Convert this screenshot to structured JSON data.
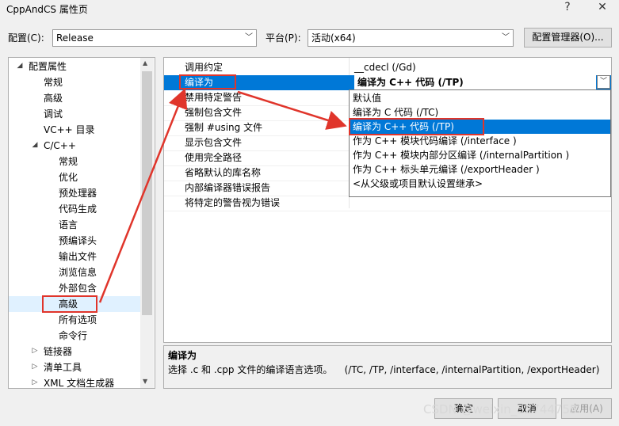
{
  "window": {
    "title": "CppAndCS 属性页",
    "help_button": "?",
    "close_button": "✕"
  },
  "config_row": {
    "config_label": "配置(C):",
    "config_value": "Release",
    "platform_label": "平台(P):",
    "platform_value": "活动(x64)",
    "manager_button": "配置管理器(O)..."
  },
  "tree": {
    "items": [
      {
        "label": "配置属性",
        "expander": "◢"
      },
      {
        "label": "常规"
      },
      {
        "label": "高级"
      },
      {
        "label": "调试"
      },
      {
        "label": "VC++ 目录"
      },
      {
        "label": "C/C++",
        "expander": "◢"
      },
      {
        "label": "常规"
      },
      {
        "label": "优化"
      },
      {
        "label": "预处理器"
      },
      {
        "label": "代码生成"
      },
      {
        "label": "语言"
      },
      {
        "label": "预编译头"
      },
      {
        "label": "输出文件"
      },
      {
        "label": "浏览信息"
      },
      {
        "label": "外部包含"
      },
      {
        "label": "高级"
      },
      {
        "label": "所有选项"
      },
      {
        "label": "命令行"
      },
      {
        "label": "链接器",
        "expander": "▷"
      },
      {
        "label": "清单工具",
        "expander": "▷"
      },
      {
        "label": "XML 文档生成器",
        "expander": "▷"
      }
    ],
    "selected_index": 15
  },
  "grid": {
    "rows": [
      {
        "name": "调用约定",
        "value": "__cdecl (/Gd)"
      },
      {
        "name": "编译为",
        "value": "编译为 C++ 代码 (/TP)"
      },
      {
        "name": "禁用特定警告",
        "value": ""
      },
      {
        "name": "强制包含文件",
        "value": ""
      },
      {
        "name": "强制 #using 文件",
        "value": ""
      },
      {
        "name": "显示包含文件",
        "value": ""
      },
      {
        "name": "使用完全路径",
        "value": ""
      },
      {
        "name": "省略默认的库名称",
        "value": ""
      },
      {
        "name": "内部编译器错误报告",
        "value": ""
      },
      {
        "name": "将特定的警告视为错误",
        "value": ""
      }
    ],
    "selected_index": 1
  },
  "dropdown": {
    "options": [
      "默认值",
      "编译为 C 代码 (/TC)",
      "编译为 C++ 代码 (/TP)",
      "作为 C++ 模块代码编译 (/interface )",
      "作为 C++ 模块内部分区编译 (/internalPartition )",
      "作为 C++ 标头单元编译 (/exportHeader )",
      "<从父级或项目默认设置继承>"
    ],
    "highlighted_index": 2
  },
  "description": {
    "title": "编译为",
    "text": "选择 .c 和 .cpp 文件的编译语言选项。    (/TC, /TP, /interface, /internalPartition, /exportHeader)"
  },
  "footer": {
    "ok_button": "确定",
    "cancel_button": "取消",
    "apply_button": "应用(A)"
  },
  "watermark": "CSDN @weixin_52744755",
  "colors": {
    "selection": "#0078d7",
    "annotation": "#e0352b",
    "tree_selected": "#cce8ff"
  }
}
